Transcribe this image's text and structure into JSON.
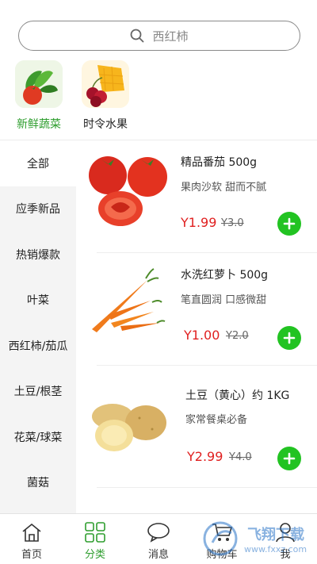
{
  "search": {
    "placeholder": "西红柿"
  },
  "top_categories": [
    {
      "label": "新鲜蔬菜",
      "icon": "vegetables-icon",
      "active": true
    },
    {
      "label": "时令水果",
      "icon": "fruits-icon",
      "active": false
    }
  ],
  "sidebar": {
    "items": [
      {
        "label": "全部",
        "active": true
      },
      {
        "label": "应季新品"
      },
      {
        "label": "热销爆款"
      },
      {
        "label": "叶菜"
      },
      {
        "label": "西红柿/茄瓜"
      },
      {
        "label": "土豆/根茎"
      },
      {
        "label": "花菜/球菜"
      },
      {
        "label": "菌菇"
      }
    ]
  },
  "products": [
    {
      "name": "精品番茄  500g",
      "desc": "果肉沙软 甜而不腻",
      "price": "Y1.99",
      "old_price": "Y3.0",
      "image": "tomato-image"
    },
    {
      "name": "水洗红萝卜  500g",
      "desc": "笔直圆润 口感微甜",
      "price": "Y1.00",
      "old_price": "Y2.0",
      "image": "carrot-image"
    },
    {
      "name": "土豆（黄心）约 1KG",
      "desc": "家常餐桌必备",
      "price": "Y2.99",
      "old_price": "Y4.0",
      "image": "potato-image"
    }
  ],
  "bottom_nav": [
    {
      "label": "首页",
      "icon": "home-icon"
    },
    {
      "label": "分类",
      "icon": "category-grid-icon",
      "active": true
    },
    {
      "label": "消息",
      "icon": "message-icon"
    },
    {
      "label": "购物车",
      "icon": "cart-icon"
    },
    {
      "label": "我",
      "icon": "user-icon"
    }
  ],
  "watermark": {
    "title": "飞翔下载",
    "url": "www.fxxz.com"
  },
  "colors": {
    "accent_green": "#2f9e2f",
    "add_button": "#22c322",
    "price_red": "#e02020"
  }
}
